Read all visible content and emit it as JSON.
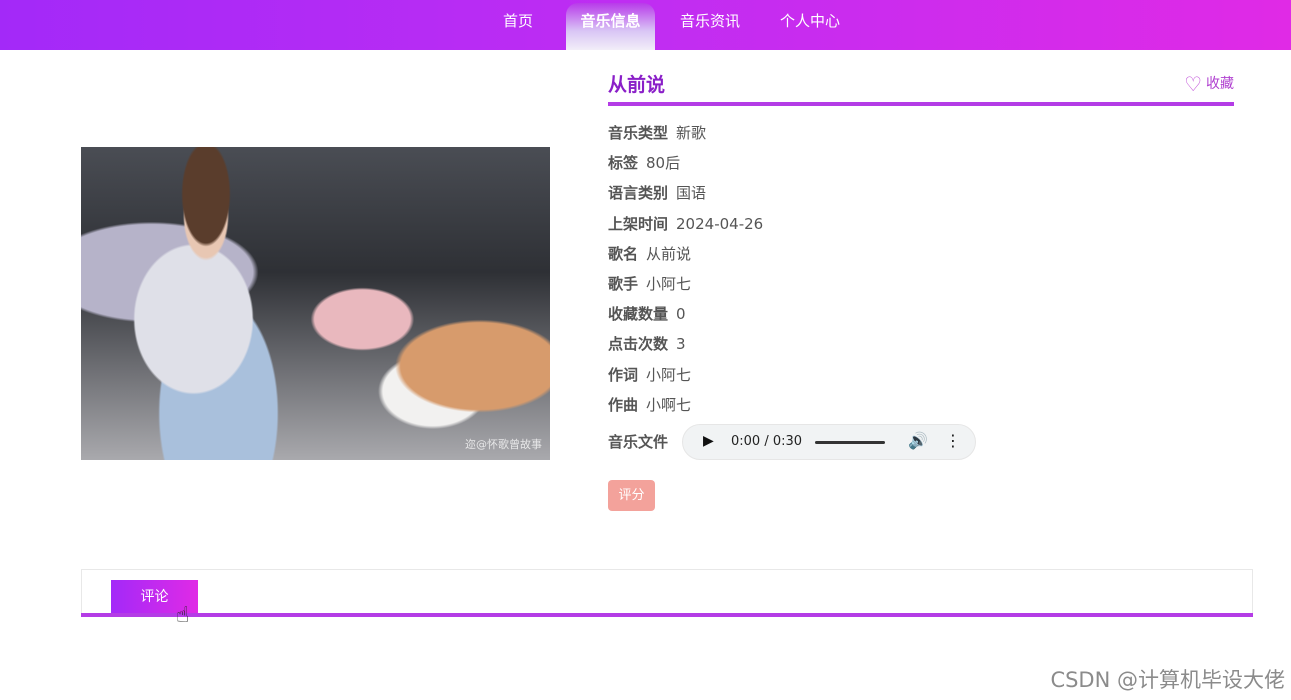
{
  "nav": {
    "items": [
      {
        "label": "首页"
      },
      {
        "label": "音乐信息"
      },
      {
        "label": "音乐资讯"
      },
      {
        "label": "个人中心"
      }
    ],
    "active_index": 1
  },
  "cover": {
    "watermark": "迩@怀歌曾故事"
  },
  "detail": {
    "title": "从前说",
    "favorite_label": "收藏",
    "fields": [
      {
        "key": "音乐类型",
        "value": "新歌"
      },
      {
        "key": "标签",
        "value": "80后"
      },
      {
        "key": "语言类别",
        "value": "国语"
      },
      {
        "key": "上架时间",
        "value": "2024-04-26"
      },
      {
        "key": "歌名",
        "value": "从前说"
      },
      {
        "key": "歌手",
        "value": "小阿七"
      },
      {
        "key": "收藏数量",
        "value": "0"
      },
      {
        "key": "点击次数",
        "value": "3"
      },
      {
        "key": "作词",
        "value": "小阿七"
      },
      {
        "key": "作曲",
        "value": "小啊七"
      }
    ],
    "audio_label": "音乐文件",
    "audio_time": "0:00 / 0:30",
    "rate_label": "评分"
  },
  "tabs": {
    "comment_label": "评论"
  },
  "footer": {
    "watermark": "CSDN @计算机毕设大佬"
  },
  "icons": {
    "favorite": "heart-outline-icon",
    "play": "play-icon",
    "volume": "volume-icon",
    "more": "more-vertical-icon",
    "cursor": "hand-pointer-icon"
  },
  "colors": {
    "accent": "#b43ce6",
    "nav_gradient_start": "#a329f8",
    "nav_gradient_end": "#e02ae6",
    "title": "#8a1fc8",
    "rate_button": "#f3a29b"
  }
}
